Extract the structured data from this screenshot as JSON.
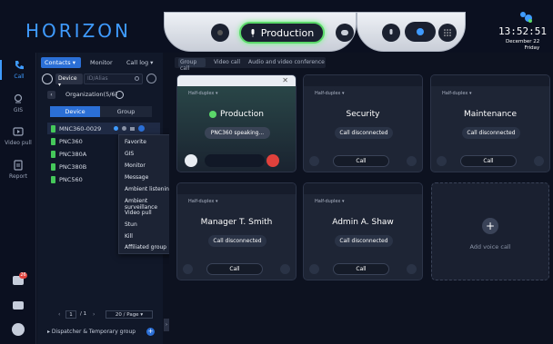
{
  "app": {
    "logo": "HORIZON"
  },
  "header": {
    "current_group": "Production",
    "time": "13:52:51",
    "date_line": "December 22",
    "weekday": "Friday"
  },
  "nav": {
    "items": [
      {
        "label": "Call",
        "icon": "phone-icon"
      },
      {
        "label": "GIS",
        "icon": "location-icon"
      },
      {
        "label": "Video pull",
        "icon": "video-icon"
      },
      {
        "label": "Report",
        "icon": "report-icon"
      }
    ],
    "notification_count": "26"
  },
  "contacts": {
    "tabs": {
      "contacts": "Contacts",
      "monitor": "Monitor",
      "call_log": "Call log"
    },
    "device_select": "Device",
    "search_placeholder": "ID/Alias",
    "org_label": "Organization(5/6)",
    "subtabs": {
      "device": "Device",
      "group": "Group"
    },
    "devices": [
      "MNC360-0029",
      "PNC360",
      "PNC380A",
      "PNC380B",
      "PNC560"
    ],
    "paging": {
      "current": "1",
      "total": "/ 1",
      "per_page": "20 / Page"
    },
    "dispatcher_group": "Dispatcher & Temporary group"
  },
  "context_menu": {
    "items": [
      "Favorite",
      "GIS",
      "Monitor",
      "Message",
      "Ambient listening",
      "Ambient surveillance",
      "Video pull",
      "Stun",
      "Kill",
      "Affiliated group"
    ]
  },
  "main": {
    "tabs": [
      "Group call",
      "Video call",
      "Audio and video conference"
    ],
    "duplex_label": "Half-duplex",
    "cards": [
      {
        "name": "Production",
        "status": "PNC360 speaking...",
        "call": ""
      },
      {
        "name": "Security",
        "status": "Call disconnected",
        "call": "Call"
      },
      {
        "name": "Maintenance",
        "status": "Call disconnected",
        "call": "Call"
      },
      {
        "name": "Manager T. Smith",
        "status": "Call disconnected",
        "call": "Call"
      },
      {
        "name": "Admin A. Shaw",
        "status": "Call disconnected",
        "call": "Call"
      }
    ],
    "add_label": "Add voice call"
  },
  "colors": {
    "accent": "#2b6fd6",
    "active_green": "#5bd86a",
    "hangup_red": "#e0413c"
  }
}
